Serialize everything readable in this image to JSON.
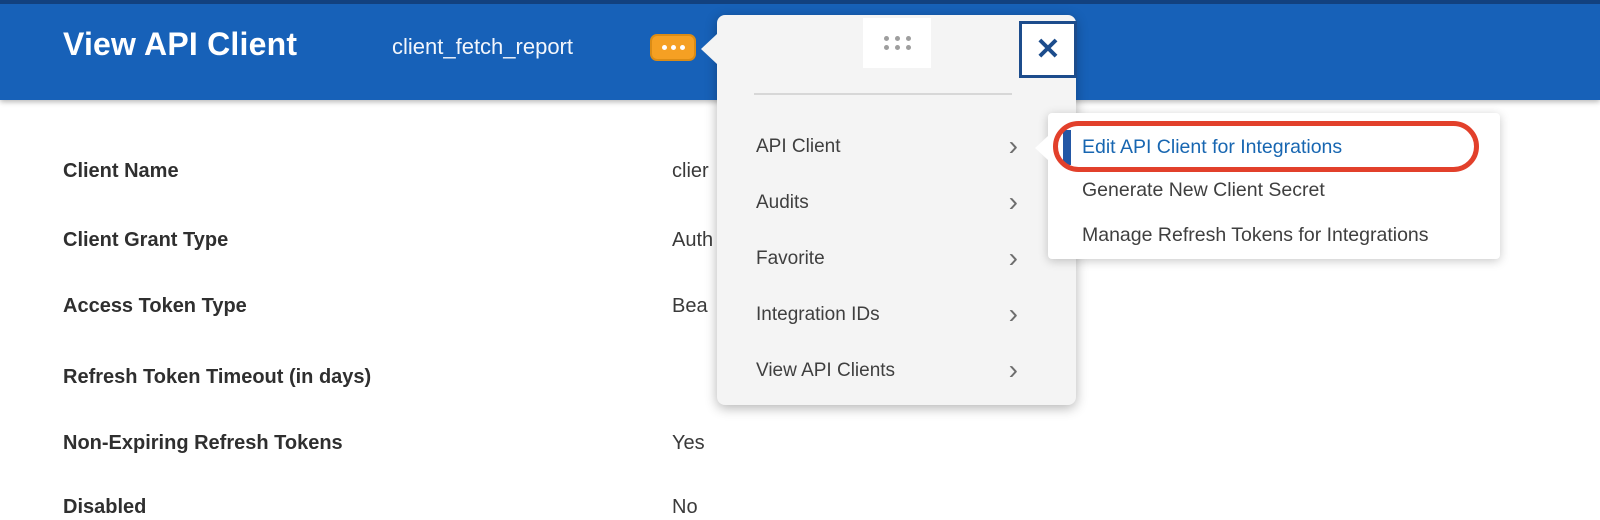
{
  "header": {
    "title": "View API Client",
    "instance": "client_fetch_report"
  },
  "fields": [
    {
      "label": "Client Name",
      "value": "clier"
    },
    {
      "label": "Client Grant Type",
      "value": "Auth"
    },
    {
      "label": "Access Token Type",
      "value": "Bea"
    },
    {
      "label": "Refresh Token Timeout (in days)",
      "value": ""
    },
    {
      "label": "Non-Expiring Refresh Tokens",
      "value": "Yes"
    },
    {
      "label": "Disabled",
      "value": "No"
    }
  ],
  "menu": {
    "items": [
      {
        "label": "API Client"
      },
      {
        "label": "Audits"
      },
      {
        "label": "Favorite"
      },
      {
        "label": "Integration IDs"
      },
      {
        "label": "View API Clients"
      }
    ]
  },
  "submenu": {
    "items": [
      {
        "label": "Edit API Client for Integrations"
      },
      {
        "label": "Generate New Client Secret"
      },
      {
        "label": "Manage Refresh Tokens for Integrations"
      }
    ]
  },
  "icons": {
    "close": "✕",
    "chevron_right": "›",
    "related_actions": "ellipsis-dots",
    "drag_handle": "six-dots-grid"
  },
  "colors": {
    "blue": "#1761B8",
    "topline": "#12417F",
    "panelbg": "#F4F4F4",
    "orange": "#F5A023",
    "orangedark": "#DB8C15",
    "red": "#E2402B",
    "link": "#1766B1",
    "navy": "#1C4C8C",
    "barblue": "#2357A5"
  }
}
